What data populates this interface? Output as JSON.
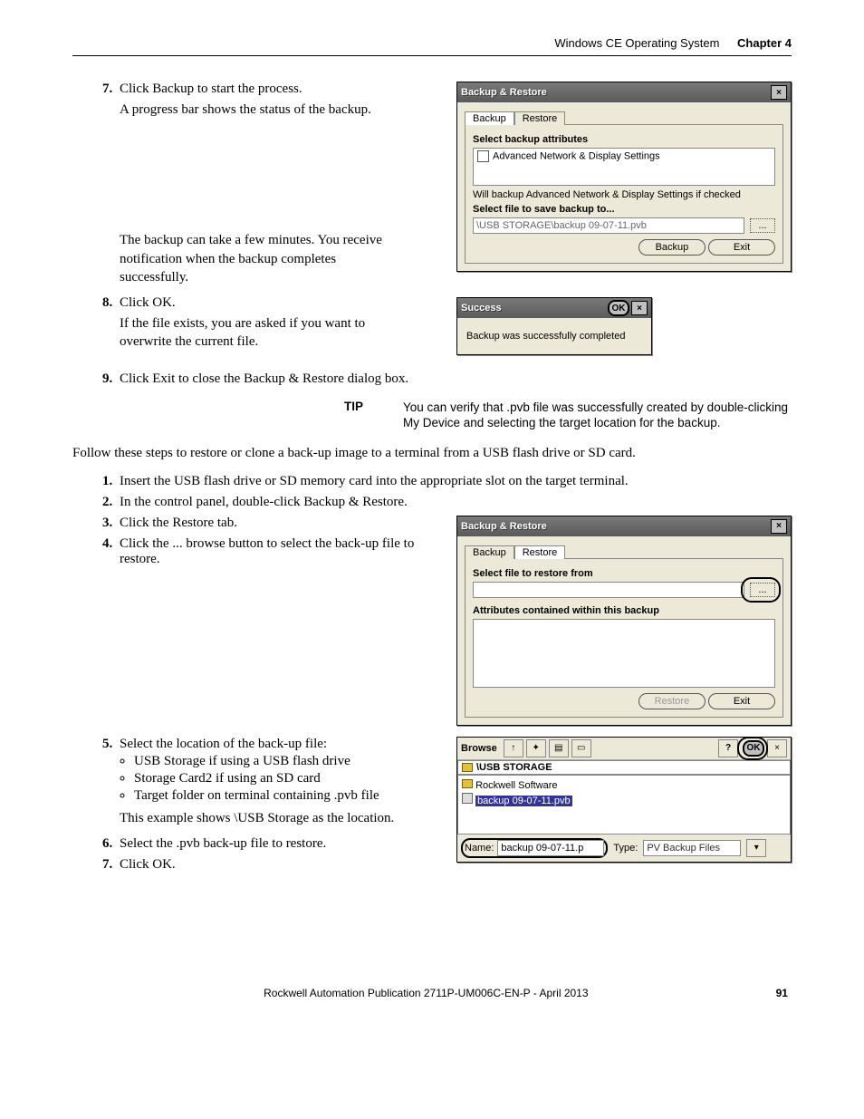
{
  "header": {
    "section": "Windows CE Operating System",
    "chapter": "Chapter 4"
  },
  "steps_a": {
    "s7": "Click Backup to start the process.",
    "s7_sub": "A progress bar shows the status of the backup.",
    "s7_note": "The backup can take a few minutes. You receive notification when the backup completes successfully.",
    "s8": "Click OK.",
    "s8_sub": "If the file exists, you are asked if you want to overwrite the current file.",
    "s9": "Click Exit to close the Backup & Restore dialog box."
  },
  "dialog_backup": {
    "title": "Backup & Restore",
    "tab_backup": "Backup",
    "tab_restore": "Restore",
    "select_attr": "Select backup attributes",
    "attr_item": "Advanced Network & Display Settings",
    "hint": "Will backup Advanced Network & Display Settings if checked",
    "select_file": "Select file to save backup to...",
    "path": "\\USB STORAGE\\backup 09-07-11.pvb",
    "browse": "...",
    "btn_backup": "Backup",
    "btn_exit": "Exit"
  },
  "dialog_success": {
    "title": "Success",
    "ok": "OK",
    "close": "×",
    "msg": "Backup was successfully completed"
  },
  "tip": {
    "label": "TIP",
    "text": "You can verify that .pvb file was successfully created by double-clicking My Device and selecting the target location for the backup."
  },
  "follow": "Follow these steps to restore or clone a back-up image to a terminal from a USB flash drive or SD card.",
  "steps_b": {
    "s1": "Insert the USB flash drive or SD memory card into the appropriate slot on the target terminal.",
    "s2": "In the control panel, double-click Backup & Restore.",
    "s3": "Click the Restore tab.",
    "s4": "Click the ... browse button to select the back-up file to restore.",
    "s5": "Select the location of the back-up file:",
    "s5_b1": "USB Storage if using a USB flash drive",
    "s5_b2": "Storage Card2 if using an SD card",
    "s5_b3": "Target folder on terminal containing .pvb file",
    "s5_note": "This example shows \\USB Storage as the location.",
    "s6": "Select the .pvb back-up file to restore.",
    "s7": "Click OK."
  },
  "dialog_restore": {
    "title": "Backup & Restore",
    "tab_backup": "Backup",
    "tab_restore": "Restore",
    "select_file": "Select file to restore from",
    "browse": "...",
    "attr_label": "Attributes contained within this backup",
    "btn_restore": "Restore",
    "btn_exit": "Exit"
  },
  "dialog_browse": {
    "title": "Browse",
    "help": "?",
    "ok": "OK",
    "close": "×",
    "location": "\\USB STORAGE",
    "item_folder": "Rockwell Software",
    "item_file": "backup 09-07-11.pvb",
    "name_label": "Name:",
    "name_value": "backup 09-07-11.p",
    "type_label": "Type:",
    "type_value": "PV Backup Files"
  },
  "footer": {
    "pub": "Rockwell Automation Publication 2711P-UM006C-EN-P - April 2013",
    "page": "91"
  }
}
